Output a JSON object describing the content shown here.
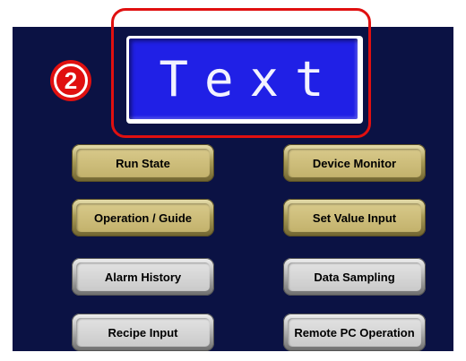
{
  "display": {
    "lcd_text": "Text"
  },
  "callout": {
    "number": "2",
    "color": "#e01010"
  },
  "buttons": {
    "run_state": "Run State",
    "device_monitor": "Device Monitor",
    "operation_guide": "Operation / Guide",
    "set_value_input": "Set Value Input",
    "alarm_history": "Alarm History",
    "data_sampling": "Data Sampling",
    "recipe_input": "Recipe Input",
    "remote_pc_operation": "Remote PC Operation"
  },
  "colors": {
    "panel_background": "#0b1244",
    "lcd_background": "#2020e6",
    "gold_button": "#c3b26c",
    "silver_button": "#cacaca"
  }
}
